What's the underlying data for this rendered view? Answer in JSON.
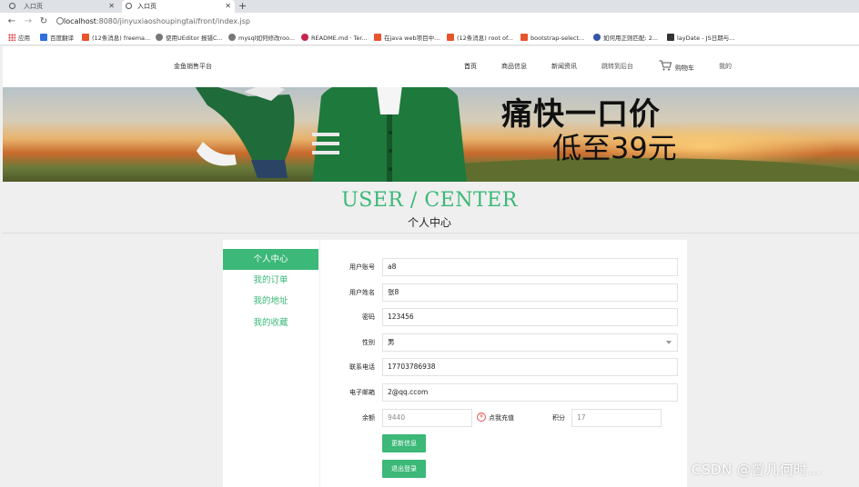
{
  "browser": {
    "tabs": [
      {
        "title": "入口页"
      },
      {
        "title": "入口页"
      }
    ],
    "new_tab": "+",
    "url_host": "localhost",
    "url_rest": ":8080/jinyuxiaoshoupingtai/front/index.jsp",
    "bookmarks": [
      {
        "label": "应用",
        "color": "#d33"
      },
      {
        "label": "百度翻译",
        "color": "#2f6fe0"
      },
      {
        "label": "(12条消息) freema...",
        "color": "#e8552c"
      },
      {
        "label": "使用UEditor 报错C...",
        "color": "#555"
      },
      {
        "label": "mysql如何修改roo...",
        "color": "#555"
      },
      {
        "label": "README.md · Ter...",
        "color": "#c7254e"
      },
      {
        "label": "在java web项目中...",
        "color": "#e8552c"
      },
      {
        "label": "(12条消息) root of...",
        "color": "#e8552c"
      },
      {
        "label": "bootstrap-select...",
        "color": "#e8552c"
      },
      {
        "label": "如何用正则匹配: 2...",
        "color": "#3355aa"
      },
      {
        "label": "layDate - JS日期与...",
        "color": "#333"
      }
    ]
  },
  "nav": {
    "brand": "金鱼销售平台",
    "items": [
      "首页",
      "商品信息",
      "新闻资讯",
      "跳转到后台"
    ],
    "cart": "购物车",
    "mine": "我的"
  },
  "banner": {
    "headline1": "痛快一口价",
    "headline2": "低至39元"
  },
  "user_center": {
    "title_en": "USER / CENTER",
    "title_cn": "个人中心"
  },
  "sidebar": {
    "items": [
      {
        "label": "个人中心",
        "active": true
      },
      {
        "label": "我的订单",
        "active": false
      },
      {
        "label": "我的地址",
        "active": false
      },
      {
        "label": "我的收藏",
        "active": false
      }
    ]
  },
  "form": {
    "account_label": "用户账号",
    "account_value": "a8",
    "name_label": "用户姓名",
    "name_value": "张8",
    "password_label": "密码",
    "password_value": "123456",
    "gender_label": "性别",
    "gender_value": "男",
    "phone_label": "联系电话",
    "phone_value": "17703786938",
    "email_label": "电子邮箱",
    "email_value": "2@qq.ccom",
    "balance_label": "余额",
    "balance_value": "9440",
    "recharge_icon": "¥",
    "recharge_label": "点我充值",
    "points_label": "积分",
    "points_value": "17",
    "update_button": "更新信息",
    "logout_button": "退出登录"
  },
  "watermark": "CSDN @曾几何时…",
  "colors": {
    "accent": "#3cb878",
    "recharge": "#e05050"
  }
}
